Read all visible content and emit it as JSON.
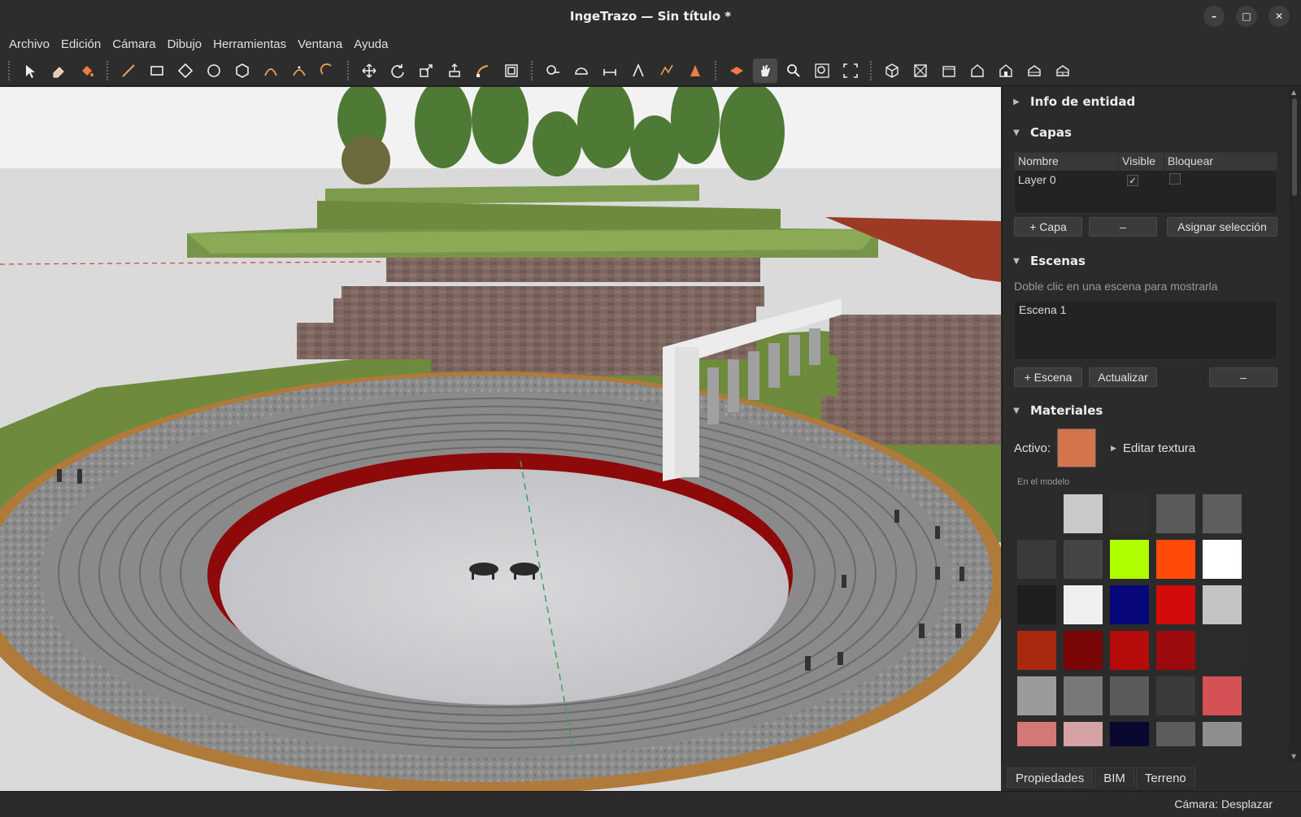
{
  "window": {
    "title": "IngeTrazo — Sin título *",
    "minimize_label": "–",
    "maximize_label": "□",
    "close_label": "✕"
  },
  "menu": [
    "Archivo",
    "Edición",
    "Cámara",
    "Dibujo",
    "Herramientas",
    "Ventana",
    "Ayuda"
  ],
  "toolbar": {
    "groups": [
      [
        "select-icon",
        "eraser-icon",
        "paint-bucket-icon"
      ],
      [
        "line-icon",
        "rectangle-icon",
        "rotated-rectangle-icon",
        "circle-icon",
        "polygon-icon",
        "arc-icon",
        "two-point-arc-icon",
        "pie-icon"
      ],
      [
        "move-icon",
        "rotate-icon",
        "scale-icon",
        "push-pull-icon",
        "follow-me-icon",
        "offset-icon"
      ],
      [
        "tape-measure-icon",
        "protractor-icon",
        "dimension-icon",
        "text-icon",
        "axes-icon",
        "3d-text-icon"
      ],
      [
        "section-plane-icon",
        "pan-hand-icon",
        "zoom-icon",
        "zoom-window-icon",
        "zoom-extents-icon"
      ],
      [
        "iso-view-icon",
        "top-view-icon",
        "front-view-icon",
        "right-view-icon",
        "back-view-icon",
        "left-view-icon",
        "bottom-view-icon"
      ]
    ],
    "active_tool": "pan-hand-icon"
  },
  "panel": {
    "entity_info": {
      "title": "Info de entidad",
      "expanded": false
    },
    "layers": {
      "title": "Capas",
      "columns": [
        "Nombre",
        "Visible",
        "Bloquear"
      ],
      "rows": [
        {
          "name": "Layer 0",
          "visible": true,
          "locked": false
        }
      ],
      "add_label": "+ Capa",
      "remove_label": "–",
      "assign_label": "Asignar selección"
    },
    "scenes": {
      "title": "Escenas",
      "hint": "Doble clic en una escena para mostrarla",
      "items": [
        "Escena 1"
      ],
      "add_label": "+ Escena",
      "update_label": "Actualizar",
      "remove_label": "–"
    },
    "materials": {
      "title": "Materiales",
      "active_label": "Activo:",
      "active_color": "#d4744a",
      "edit_texture_label": "Editar textura",
      "in_model_label": "En el modelo",
      "swatches": [
        [
          null,
          "#c9c9c9",
          "#2f2f2f",
          "#5a5a5a",
          "#5e5e5e"
        ],
        [
          "#3a3a3a",
          "#444444",
          "#b0ff00",
          "#ff4a0a",
          "#ffffff"
        ],
        [
          "#1e1e1e",
          "#efefef",
          "#07077a",
          "#d40b0b",
          "#c3c3c3"
        ],
        [
          "#a8290e",
          "#7a0606",
          "#b50b0b",
          "#9c0a0e",
          "#2c2c2c"
        ],
        [
          "#9a9a9a",
          "#787878",
          "#5a5a5a",
          "#3a3a3a",
          "#d45256"
        ],
        [
          "#d47777",
          "#d4a2a2",
          "#070730",
          "#5c5c5c",
          "#8e8e8e"
        ]
      ]
    }
  },
  "tabs": [
    "Propiedades",
    "BIM",
    "Terreno"
  ],
  "status": "Cámara: Desplazar",
  "colors": {
    "chrome_bg": "#2d2d2d",
    "panel_bg": "#2b2b2b",
    "accent_active_material": "#d4744a"
  }
}
